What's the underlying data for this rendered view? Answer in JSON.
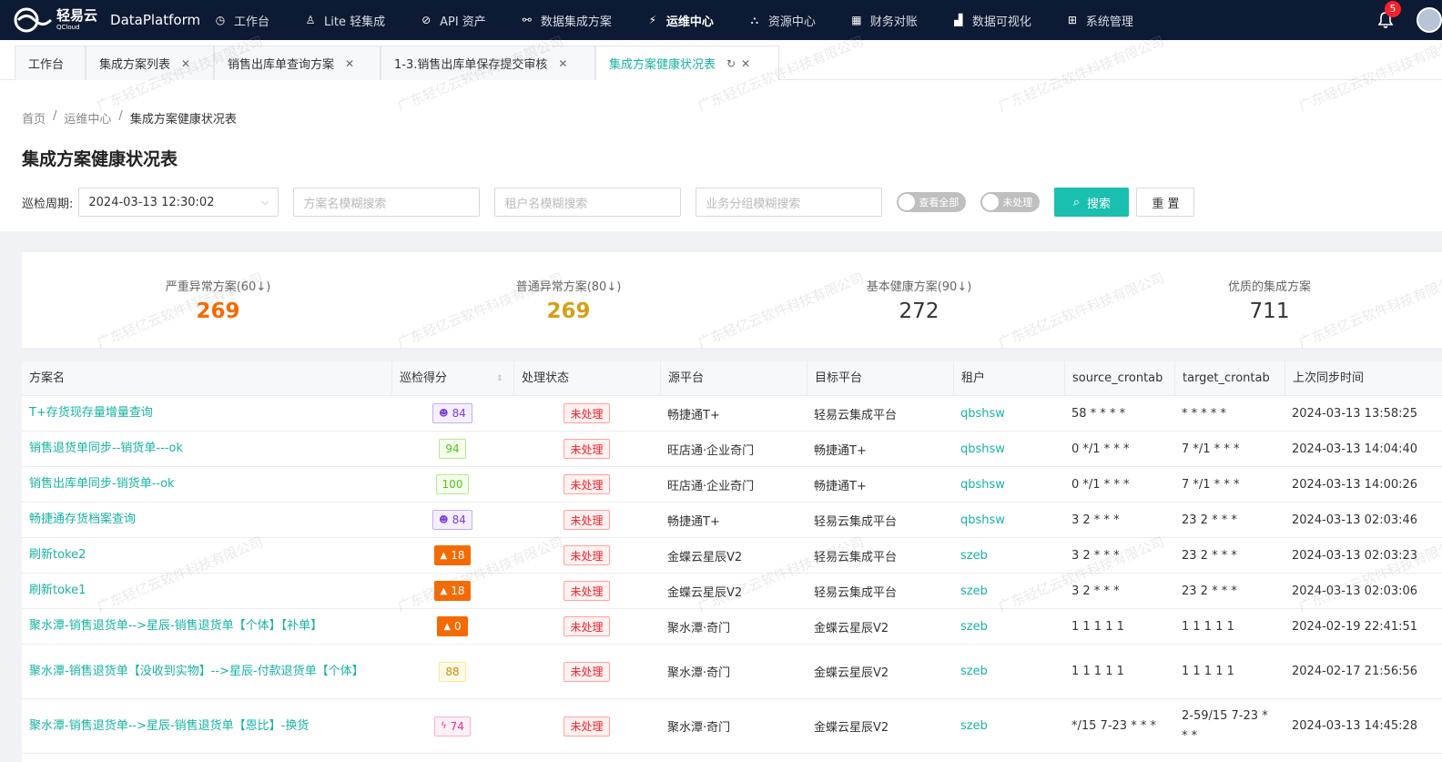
{
  "brand": {
    "cn": "轻易云",
    "en": "QCloud",
    "product": "DataPlatform"
  },
  "nav": [
    {
      "label": "工作台",
      "icon": "clock-icon"
    },
    {
      "label": "Lite 轻集成",
      "icon": "lite-icon"
    },
    {
      "label": "API 资产",
      "icon": "compass-icon"
    },
    {
      "label": "数据集成方案",
      "icon": "network-icon"
    },
    {
      "label": "运维中心",
      "icon": "bolt-icon",
      "active": true
    },
    {
      "label": "资源中心",
      "icon": "tree-icon"
    },
    {
      "label": "财务对账",
      "icon": "calculator-icon"
    },
    {
      "label": "数据可视化",
      "icon": "chart-icon"
    },
    {
      "label": "系统管理",
      "icon": "grid-icon"
    }
  ],
  "notifications": {
    "count": "5"
  },
  "tabs": [
    {
      "label": "工作台"
    },
    {
      "label": "集成方案列表"
    },
    {
      "label": "销售出库单查询方案"
    },
    {
      "label": "1-3.销售出库单保存提交审核"
    },
    {
      "label": "集成方案健康状况表"
    }
  ],
  "breadcrumb": {
    "home": "首页",
    "section": "运维中心",
    "current": "集成方案健康状况表"
  },
  "page_title": "集成方案健康状况表",
  "filters": {
    "period_label": "巡检周期:",
    "period_value": "2024-03-13 12:30:02",
    "plan_placeholder": "方案名模糊搜索",
    "tenant_placeholder": "租户名模糊搜索",
    "group_placeholder": "业务分组模糊搜索",
    "toggle_all": "查看全部",
    "toggle_unhandled": "未处理",
    "search": "搜索",
    "reset": "重 置"
  },
  "stats": [
    {
      "label": "严重异常方案(60↓)",
      "value": "269",
      "color": "#f56a00"
    },
    {
      "label": "普通异常方案(80↓)",
      "value": "269",
      "color": "#d4a017"
    },
    {
      "label": "基本健康方案(90↓)",
      "value": "272",
      "color": "#333333"
    },
    {
      "label": "优质的集成方案",
      "value": "711",
      "color": "#333333"
    }
  ],
  "table": {
    "headers": [
      "方案名",
      "巡检得分",
      "处理状态",
      "源平台",
      "目标平台",
      "租户",
      "source_crontab",
      "target_crontab",
      "上次同步时间"
    ],
    "rows": [
      {
        "name": "T+存货现存量增量查询",
        "score": "84",
        "score_style": "purple",
        "score_icon": "smile-icon",
        "status": "未处理",
        "source": "畅捷通T+",
        "target": "轻易云集成平台",
        "tenant": "qbshsw",
        "src_cron": "58 * * * *",
        "tgt_cron": "* * * * *",
        "last_sync": "2024-03-13 13:58:25"
      },
      {
        "name": "销售退货单同步--销货单---ok",
        "score": "94",
        "score_style": "green",
        "score_icon": "",
        "status": "未处理",
        "source": "旺店通·企业奇门",
        "target": "畅捷通T+",
        "tenant": "qbshsw",
        "src_cron": "0 */1 * * *",
        "tgt_cron": "7 */1 * * *",
        "last_sync": "2024-03-13 14:04:40"
      },
      {
        "name": "销售出库单同步-销货单--ok",
        "score": "100",
        "score_style": "green",
        "score_icon": "",
        "status": "未处理",
        "source": "旺店通·企业奇门",
        "target": "畅捷通T+",
        "tenant": "qbshsw",
        "src_cron": "0 */1 * * *",
        "tgt_cron": "7 */1 * * *",
        "last_sync": "2024-03-13 14:00:26"
      },
      {
        "name": "畅捷通存货档案查询",
        "score": "84",
        "score_style": "purple",
        "score_icon": "smile-icon",
        "status": "未处理",
        "source": "畅捷通T+",
        "target": "轻易云集成平台",
        "tenant": "qbshsw",
        "src_cron": "3 2 * * *",
        "tgt_cron": "23 2 * * *",
        "last_sync": "2024-03-13 02:03:46"
      },
      {
        "name": "刷新toke2",
        "score": "18",
        "score_style": "orange",
        "score_icon": "warning-icon",
        "status": "未处理",
        "source": "金蝶云星辰V2",
        "target": "轻易云集成平台",
        "tenant": "szeb",
        "src_cron": "3 2 * * *",
        "tgt_cron": "23 2 * * *",
        "last_sync": "2024-03-13 02:03:23"
      },
      {
        "name": "刷新toke1",
        "score": "18",
        "score_style": "orange",
        "score_icon": "warning-icon",
        "status": "未处理",
        "source": "金蝶云星辰V2",
        "target": "轻易云集成平台",
        "tenant": "szeb",
        "src_cron": "3 2 * * *",
        "tgt_cron": "23 2 * * *",
        "last_sync": "2024-03-13 02:03:06"
      },
      {
        "name": "聚水潭-销售退货单-->星辰-销售退货单【个体】【补单】",
        "score": "0",
        "score_style": "orange",
        "score_icon": "warning-icon",
        "status": "未处理",
        "source": "聚水潭·奇门",
        "target": "金蝶云星辰V2",
        "tenant": "szeb",
        "src_cron": "1 1 1 1 1",
        "tgt_cron": "1 1 1 1 1",
        "last_sync": "2024-02-19 22:41:51"
      },
      {
        "name": "聚水潭-销售退货单【没收到实物】-->星辰-付款退货单【个体】",
        "score": "88",
        "score_style": "gold",
        "score_icon": "",
        "status": "未处理",
        "source": "聚水潭·奇门",
        "target": "金蝶云星辰V2",
        "tenant": "szeb",
        "src_cron": "1 1 1 1 1",
        "tgt_cron": "1 1 1 1 1",
        "last_sync": "2024-02-17 21:56:56"
      },
      {
        "name": "聚水潭-销售退货单-->星辰-销售退货单【恩比】-换货",
        "score": "74",
        "score_style": "pink",
        "score_icon": "bolt-icon",
        "status": "未处理",
        "source": "聚水潭·奇门",
        "target": "金蝶云星辰V2",
        "tenant": "szeb",
        "src_cron": "*/15 7-23 * * *",
        "tgt_cron": "2-59/15 7-23 * * *",
        "last_sync": "2024-03-13 14:45:28"
      }
    ]
  },
  "watermark": "广东轻亿云软件科技有限公司"
}
